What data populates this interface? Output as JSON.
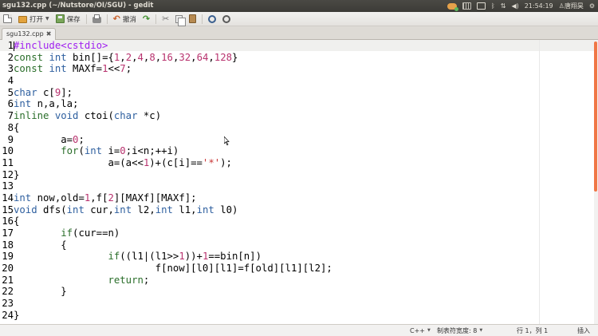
{
  "window": {
    "title": "sgu132.cpp (~/Nutstore/OI/SGU) - gedit",
    "tray": {
      "time": "21:54:19",
      "user": "唐翔昊"
    }
  },
  "toolbar": {
    "open_label": "打开",
    "save_label": "保存",
    "undo_label": "撤消"
  },
  "tabs": [
    {
      "label": "sgu132.cpp",
      "close_glyph": "✖"
    }
  ],
  "editor": {
    "lines": [
      {
        "n": "1",
        "code": "#include<cstdio>"
      },
      {
        "n": "2",
        "code": "const int bin[]={1,2,4,8,16,32,64,128}"
      },
      {
        "n": "3",
        "code": "const int MAXf=1<<7;"
      },
      {
        "n": "4",
        "code": ""
      },
      {
        "n": "5",
        "code": "char c[9];"
      },
      {
        "n": "6",
        "code": "int n,a,la;"
      },
      {
        "n": "7",
        "code": "inline void ctoi(char *c)"
      },
      {
        "n": "8",
        "code": "{"
      },
      {
        "n": "9",
        "code": "        a=0;"
      },
      {
        "n": "10",
        "code": "        for(int i=0;i<n;++i)"
      },
      {
        "n": "11",
        "code": "                a=(a<<1)+(c[i]=='*');"
      },
      {
        "n": "12",
        "code": "}"
      },
      {
        "n": "13",
        "code": ""
      },
      {
        "n": "14",
        "code": "int now,old=1,f[2][MAXf][MAXf];"
      },
      {
        "n": "15",
        "code": "void dfs(int cur,int l2,int l1,int l0)"
      },
      {
        "n": "16",
        "code": "{"
      },
      {
        "n": "17",
        "code": "        if(cur==n)"
      },
      {
        "n": "18",
        "code": "        {"
      },
      {
        "n": "19",
        "code": "                if((l1|(l1>>1))+1==bin[n])"
      },
      {
        "n": "20",
        "code": "                        f[now][l0][l1]=f[old][l1][l2];"
      },
      {
        "n": "21",
        "code": "                return;"
      },
      {
        "n": "22",
        "code": "        }"
      },
      {
        "n": "23",
        "code": ""
      },
      {
        "n": "24",
        "code": "}"
      }
    ]
  },
  "statusbar": {
    "language": "C++",
    "tab_width": "制表符宽度: 8",
    "position": "行 1，列 1",
    "mode": "插入"
  }
}
